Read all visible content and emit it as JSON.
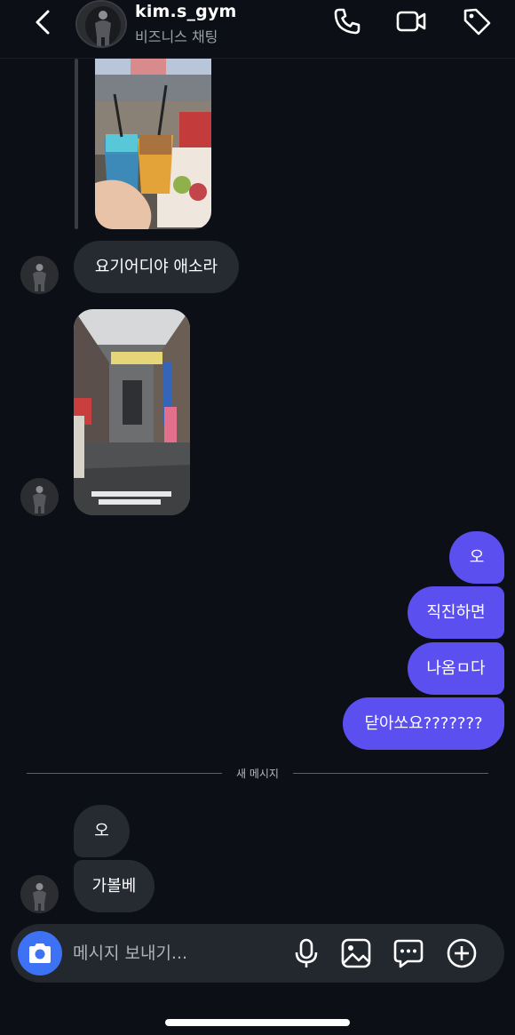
{
  "header": {
    "username": "kim.s_gym",
    "subtitle": "비즈니스 채팅"
  },
  "messages": {
    "incoming_1": "요기어디야 애소라",
    "outgoing_1": "오",
    "outgoing_2": "직진하면",
    "outgoing_3": "나옴ㅁ다",
    "outgoing_4": "닫아쏘요???????",
    "incoming_2": "오",
    "incoming_3": "가볼베"
  },
  "divider": {
    "label": "새 메시지"
  },
  "composer": {
    "placeholder": "메시지 보내기..."
  },
  "colors": {
    "background": "#0c0f15",
    "incoming_bubble": "#262a31",
    "outgoing_bubble": "#5b4ff0",
    "camera_button": "#3e72f5"
  }
}
